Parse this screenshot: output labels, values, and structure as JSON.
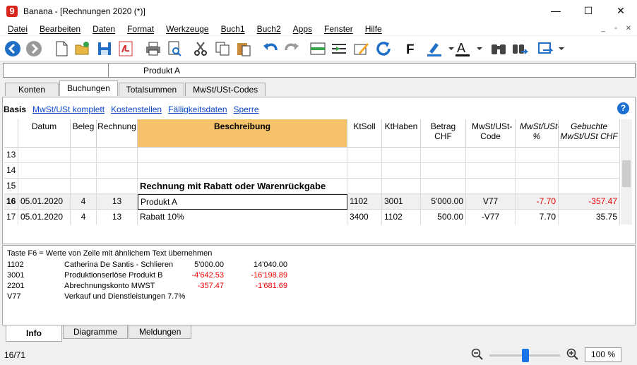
{
  "window": {
    "app_icon": "9",
    "title": "Banana - [Rechnungen 2020 (*)]",
    "minimize": "—",
    "maximize": "☐",
    "close": "✕"
  },
  "menu": {
    "items": [
      "Datei",
      "Bearbeiten",
      "Daten",
      "Format",
      "Werkzeuge",
      "Buch1",
      "Buch2",
      "Apps",
      "Fenster",
      "Hilfe"
    ],
    "mdi": [
      "_",
      "▫",
      "✕"
    ]
  },
  "field": {
    "value": "Produkt A"
  },
  "tabs": [
    "Konten",
    "Buchungen",
    "Totalsummen",
    "MwSt/USt-Codes"
  ],
  "active_tab": "Buchungen",
  "views": {
    "active": "Basis",
    "links": [
      "MwSt/USt komplett",
      "Kostenstellen",
      "Fälligkeitsdaten",
      "Sperre"
    ]
  },
  "help_label": "?",
  "table": {
    "headers": {
      "datum": "Datum",
      "beleg": "Beleg",
      "rechnung": "Rechnung",
      "beschreibung": "Beschreibung",
      "ktsoll": "KtSoll",
      "kthaben": "KtHaben",
      "betrag": "Betrag CHF",
      "mwst_code": "MwSt/USt-Code",
      "mwst_pct": "MwSt/USt-%",
      "gebuchte": "Gebuchte MwSt/USt CHF"
    },
    "rows": [
      {
        "n": "13",
        "datum": "",
        "beleg": "",
        "rechnung": "",
        "beschreibung": "",
        "ktsoll": "",
        "kthaben": "",
        "betrag": "",
        "mwst_code": "",
        "mwst_pct": "",
        "gebuchte": ""
      },
      {
        "n": "14",
        "datum": "",
        "beleg": "",
        "rechnung": "",
        "beschreibung": "",
        "ktsoll": "",
        "kthaben": "",
        "betrag": "",
        "mwst_code": "",
        "mwst_pct": "",
        "gebuchte": ""
      },
      {
        "n": "15",
        "datum": "",
        "beleg": "",
        "rechnung": "",
        "beschreibung": "Rechnung mit Rabatt oder Warenrückgabe",
        "ktsoll": "",
        "kthaben": "",
        "betrag": "",
        "mwst_code": "",
        "mwst_pct": "",
        "gebuchte": ""
      },
      {
        "n": "16",
        "datum": "05.01.2020",
        "beleg": "4",
        "rechnung": "13",
        "beschreibung": "Produkt A",
        "ktsoll": "1102",
        "kthaben": "3001",
        "betrag": "5'000.00",
        "mwst_code": "V77",
        "mwst_pct": "-7.70",
        "gebuchte": "-357.47"
      },
      {
        "n": "17",
        "datum": "05.01.2020",
        "beleg": "4",
        "rechnung": "13",
        "beschreibung": "Rabatt 10%",
        "ktsoll": "3400",
        "kthaben": "1102",
        "betrag": "500.00",
        "mwst_code": "-V77",
        "mwst_pct": "7.70",
        "gebuchte": "35.75"
      }
    ]
  },
  "info": {
    "hint": "Taste F6 = Werte von Zeile mit ähnlichem Text übernehmen",
    "lines": [
      {
        "code": "1102",
        "name": "Catherina De Santis - Schlieren",
        "a": "5'000.00",
        "b": "14'040.00",
        "a_red": false,
        "b_red": false
      },
      {
        "code": "3001",
        "name": "Produktionserlöse Produkt B",
        "a": "-4'642.53",
        "b": "-16'198.89",
        "a_red": true,
        "b_red": true
      },
      {
        "code": "2201",
        "name": "Abrechnungskonto MWST",
        "a": "-357.47",
        "b": "-1'681.69",
        "a_red": true,
        "b_red": true
      },
      {
        "code": "V77",
        "name": "Verkauf und Dienstleistungen 7.7%",
        "a": "",
        "b": "",
        "a_red": false,
        "b_red": false
      }
    ]
  },
  "bottom_tabs": [
    "Info",
    "Diagramme",
    "Meldungen"
  ],
  "status": {
    "position": "16/71",
    "zoom": "100 %",
    "zoom_level": 0.5
  },
  "colors": {
    "selected_header": "#f5c16b",
    "negative": "#e00000",
    "link": "#0b46c8",
    "accent": "#1a73e8"
  }
}
